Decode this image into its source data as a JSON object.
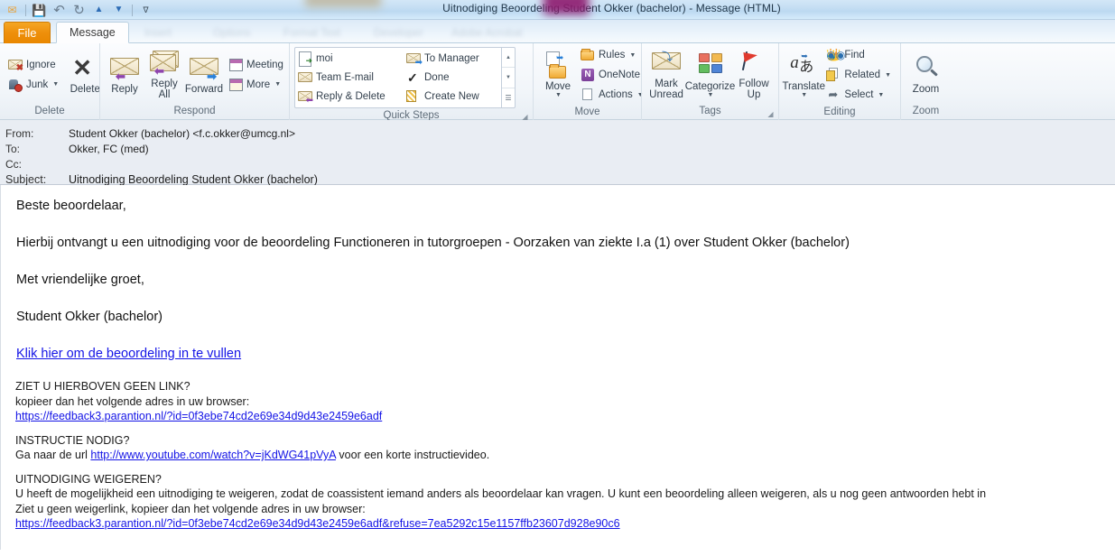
{
  "window": {
    "title": "Uitnodiging Beoordeling Student  Okker (bachelor)  -  Message (HTML)"
  },
  "quick_access": {
    "items": [
      {
        "name": "mail-icon",
        "glyph": "✉"
      },
      {
        "name": "save-icon",
        "glyph": "💾"
      },
      {
        "name": "undo-icon",
        "glyph": "↶"
      },
      {
        "name": "redo-icon",
        "glyph": "↻"
      },
      {
        "name": "previous-item-icon",
        "glyph": "▲"
      },
      {
        "name": "next-item-icon",
        "glyph": "▼"
      },
      {
        "name": "customize-toolbar-icon",
        "glyph": "∇"
      }
    ]
  },
  "tabs": {
    "file": "File",
    "message": "Message",
    "ghost": [
      "Insert",
      "Options",
      "Format Text",
      "Developer",
      "Adobe Acrobat"
    ]
  },
  "ribbon": {
    "groups": [
      {
        "label": "Delete",
        "small": [
          {
            "label": "Ignore",
            "icon": "ignore-icon",
            "caret": false
          },
          {
            "label": "Junk",
            "icon": "junk-icon",
            "caret": true
          }
        ],
        "big": [
          {
            "label": "Delete",
            "icon": "delete-icon"
          }
        ]
      },
      {
        "label": "Respond",
        "big": [
          {
            "label": "Reply",
            "icon": "reply-icon"
          },
          {
            "label": "Reply\nAll",
            "icon": "reply-all-icon"
          },
          {
            "label": "Forward",
            "icon": "forward-icon"
          }
        ],
        "small": [
          {
            "label": "Meeting",
            "icon": "meeting-icon",
            "caret": false
          },
          {
            "label": "More",
            "icon": "more-respond-icon",
            "caret": true
          }
        ]
      },
      {
        "label": "Quick Steps",
        "gallery_col1": [
          {
            "label": "moi",
            "icon": "quickstep-moi-icon"
          },
          {
            "label": "Team E-mail",
            "icon": "quickstep-team-email-icon"
          },
          {
            "label": "Reply & Delete",
            "icon": "quickstep-reply-delete-icon"
          }
        ],
        "gallery_col2": [
          {
            "label": "To Manager",
            "icon": "quickstep-to-manager-icon"
          },
          {
            "label": "Done",
            "icon": "quickstep-done-icon"
          },
          {
            "label": "Create New",
            "icon": "quickstep-create-new-icon"
          }
        ],
        "scroll": [
          "▲",
          "▼",
          "☰"
        ]
      },
      {
        "label": "Move",
        "big": [
          {
            "label": "Move",
            "icon": "move-icon",
            "caret": true
          }
        ],
        "small": [
          {
            "label": "Rules",
            "icon": "rules-icon",
            "caret": true
          },
          {
            "label": "OneNote",
            "icon": "onenote-icon",
            "caret": false
          },
          {
            "label": "Actions",
            "icon": "actions-icon",
            "caret": true
          }
        ]
      },
      {
        "label": "Tags",
        "big": [
          {
            "label": "Mark\nUnread",
            "icon": "mark-unread-icon"
          },
          {
            "label": "Categorize",
            "icon": "categorize-icon",
            "caret": true
          },
          {
            "label": "Follow\nUp",
            "icon": "follow-up-icon",
            "caret": true
          }
        ]
      },
      {
        "label": "Editing",
        "big": [
          {
            "label": "Translate",
            "icon": "translate-icon",
            "caret": true
          }
        ],
        "small": [
          {
            "label": "Find",
            "icon": "find-icon",
            "caret": false
          },
          {
            "label": "Related",
            "icon": "related-icon",
            "caret": true
          },
          {
            "label": "Select",
            "icon": "select-icon",
            "caret": true
          }
        ]
      },
      {
        "label": "Zoom",
        "big": [
          {
            "label": "Zoom",
            "icon": "zoom-icon"
          }
        ]
      }
    ]
  },
  "message_header": {
    "from_label": "From:",
    "from_value": "Student Okker (bachelor) <f.c.okker@umcg.nl>",
    "to_label": "To:",
    "to_value": "Okker, FC (med)",
    "cc_label": "Cc:",
    "cc_value": "",
    "subject_label": "Subject:",
    "subject_value": "Uitnodiging Beoordeling Student  Okker (bachelor)"
  },
  "body": {
    "greeting": "Beste beoordelaar,",
    "intro": "Hierbij ontvangt u een uitnodiging voor de beoordeling Functioneren in tutorgroepen - Oorzaken van ziekte I.a (1) over Student Okker (bachelor)",
    "closing": "Met vriendelijke groet,",
    "sender": "Student Okker (bachelor)",
    "cta_link": "Klik hier om de beoordeling in te vullen",
    "no_link_heading": "ZIET U HIERBOVEN GEEN LINK?",
    "no_link_text": "kopieer dan het volgende adres in uw browser:",
    "no_link_url": "https://feedback3.parantion.nl/?id=0f3ebe74cd2e69e34d9d43e2459e6adf",
    "instruction_heading": "INSTRUCTIE NODIG?",
    "instruction_prefix": "Ga naar de url ",
    "instruction_url": "http://www.youtube.com/watch?v=jKdWG41pVyA",
    "instruction_suffix": " voor een korte instructievideo.",
    "refuse_heading": "UITNODIGING WEIGEREN?",
    "refuse_text": "U heeft de mogelijkheid een uitnodiging te weigeren, zodat de coassistent iemand anders als beoordelaar kan vragen. U kunt een beoordeling alleen weigeren, als u nog geen antwoorden hebt in",
    "refuse_text2": "Ziet u geen weigerlink, kopieer dan het volgende adres in uw browser:",
    "refuse_url": "https://feedback3.parantion.nl/?id=0f3ebe74cd2e69e34d9d43e2459e6adf&refuse=7ea5292c15e1157ffb23607d928e90c6"
  },
  "colors": {
    "file_tab": "#ee8f0b",
    "link": "#1414e6",
    "header_bg": "#e9edf3",
    "redaction_magenta": "#8e1a6e",
    "redaction_tan": "#bdb49a"
  }
}
